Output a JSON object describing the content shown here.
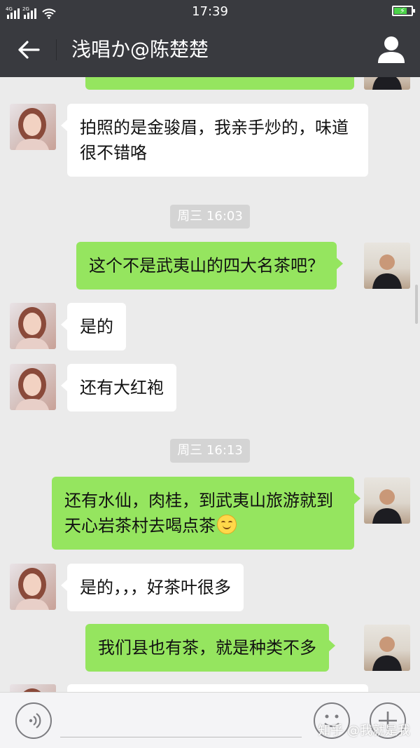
{
  "status_bar": {
    "time": "17:39",
    "sim1_tag": "4G",
    "sim2_tag": "2G",
    "battery_level": 0.75,
    "charging": true
  },
  "nav": {
    "title": "浅唱か@陈楚楚",
    "back_icon": "back-arrow-icon",
    "profile_icon": "person-icon"
  },
  "messages": [
    {
      "type": "text",
      "side": "in",
      "text": "拍照的是金骏眉，我亲手炒的，味道很不错咯"
    },
    {
      "type": "time",
      "text": "周三 16:03"
    },
    {
      "type": "text",
      "side": "out",
      "text": "这个不是武夷山的四大名茶吧？"
    },
    {
      "type": "text",
      "side": "in",
      "text": "是的"
    },
    {
      "type": "text",
      "side": "in",
      "text": "还有大红袍"
    },
    {
      "type": "time",
      "text": "周三 16:13"
    },
    {
      "type": "text",
      "side": "out",
      "text": "还有水仙，肉桂，到武夷山旅游就到天心岩茶村去喝点茶",
      "emoji": "smile-emoji-icon"
    },
    {
      "type": "text",
      "side": "in",
      "text": "是的，，，好茶叶很多"
    },
    {
      "type": "text",
      "side": "out",
      "text": "我们县也有茶，就是种类不多"
    }
  ],
  "input_bar": {
    "voice_icon": "voice-icon",
    "emoji_icon": "emoji-face-icon",
    "plus_icon": "plus-icon",
    "message_value": "",
    "watermark": "知乎 @我就是我"
  },
  "colors": {
    "header": "#393a3f",
    "background": "#ebebeb",
    "out_bubble": "#95e55f",
    "in_bubble": "#ffffff",
    "timestamp_pill": "#d4d4d4"
  }
}
